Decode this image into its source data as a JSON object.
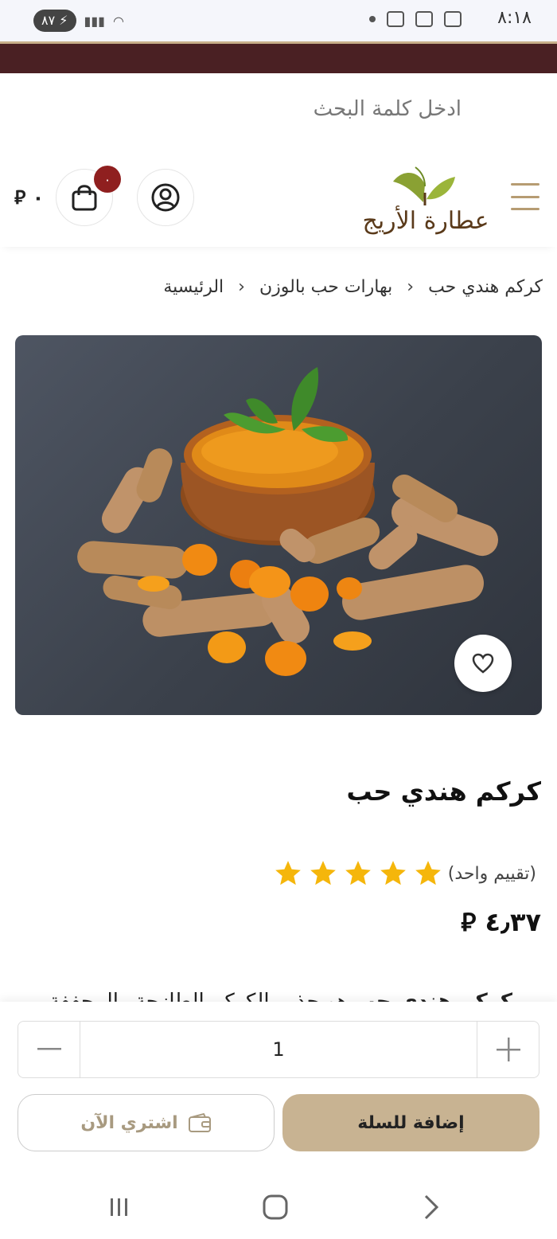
{
  "status_bar": {
    "time": "٨:١٨",
    "battery": "٨٧"
  },
  "search": {
    "placeholder": "ادخل كلمة البحث"
  },
  "header": {
    "logo_text": "عطارة الأريج",
    "cart_count": "٠",
    "cart_total": "٠ ⃁"
  },
  "breadcrumb": {
    "items": [
      "الرئيسية",
      "بهارات حب بالوزن",
      "كركم هندي حب"
    ]
  },
  "product": {
    "title": "كركم هندي حب",
    "rating_stars": 5,
    "rating_text": "(تقييم واحد)",
    "price": "٤٫٣٧ ⃁",
    "description_bold": "كركم هندي حب",
    "description_rest": " هو جذور الكركم الطازجة والمجففة"
  },
  "purchase": {
    "quantity": "1",
    "add_to_cart_label": "إضافة للسلة",
    "buy_now_label": "اشتري الآن"
  },
  "colors": {
    "brand_stripe": "#4a2023",
    "accent": "#c8b392",
    "badge": "#8f1f1f",
    "star": "#f5b60b"
  }
}
